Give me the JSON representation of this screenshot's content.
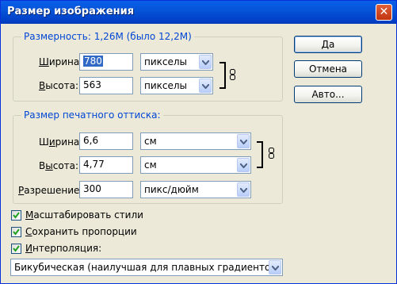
{
  "window": {
    "title": "Размер изображения",
    "close_glyph": "✕"
  },
  "buttons": {
    "ok": "Да",
    "cancel": "Отмена",
    "auto": "Авто..."
  },
  "pixel_dimensions": {
    "legend": "Размерность:  1,26M (было 12,2M)",
    "width": {
      "label_mnemonic": "Ш",
      "label_rest": "ирина:",
      "value": "780",
      "unit": "пикселы"
    },
    "height": {
      "label_mnemonic": "В",
      "label_rest": "ысота:",
      "value": "563",
      "unit": "пикселы"
    }
  },
  "document_size": {
    "legend": "Размер печатного оттиска:",
    "width": {
      "label_pre": "Ш",
      "label_mnemonic": "и",
      "label_rest": "рина:",
      "value": "6,6",
      "unit": "см"
    },
    "height": {
      "label_pre": "В",
      "label_mnemonic": "ы",
      "label_rest": "сота:",
      "value": "4,77",
      "unit": "см"
    },
    "resolution": {
      "label_mnemonic": "Р",
      "label_rest": "азрешение:",
      "value": "300",
      "unit": "пикс/дюйм"
    }
  },
  "options": {
    "scale_styles": {
      "mnemonic": "М",
      "rest": "асштабировать стили",
      "checked": true
    },
    "constrain": {
      "mnemonic": "С",
      "rest": "охранить пропорции",
      "checked": true
    },
    "resample": {
      "mnemonic": "И",
      "rest": "нтерполяция:",
      "checked": true
    },
    "method": "Бикубическая (наилучшая для плавных градиентов)"
  },
  "colors": {
    "titlebar": "#0a5ee8",
    "legend_text": "#0046d5",
    "selection": "#316ac5"
  }
}
